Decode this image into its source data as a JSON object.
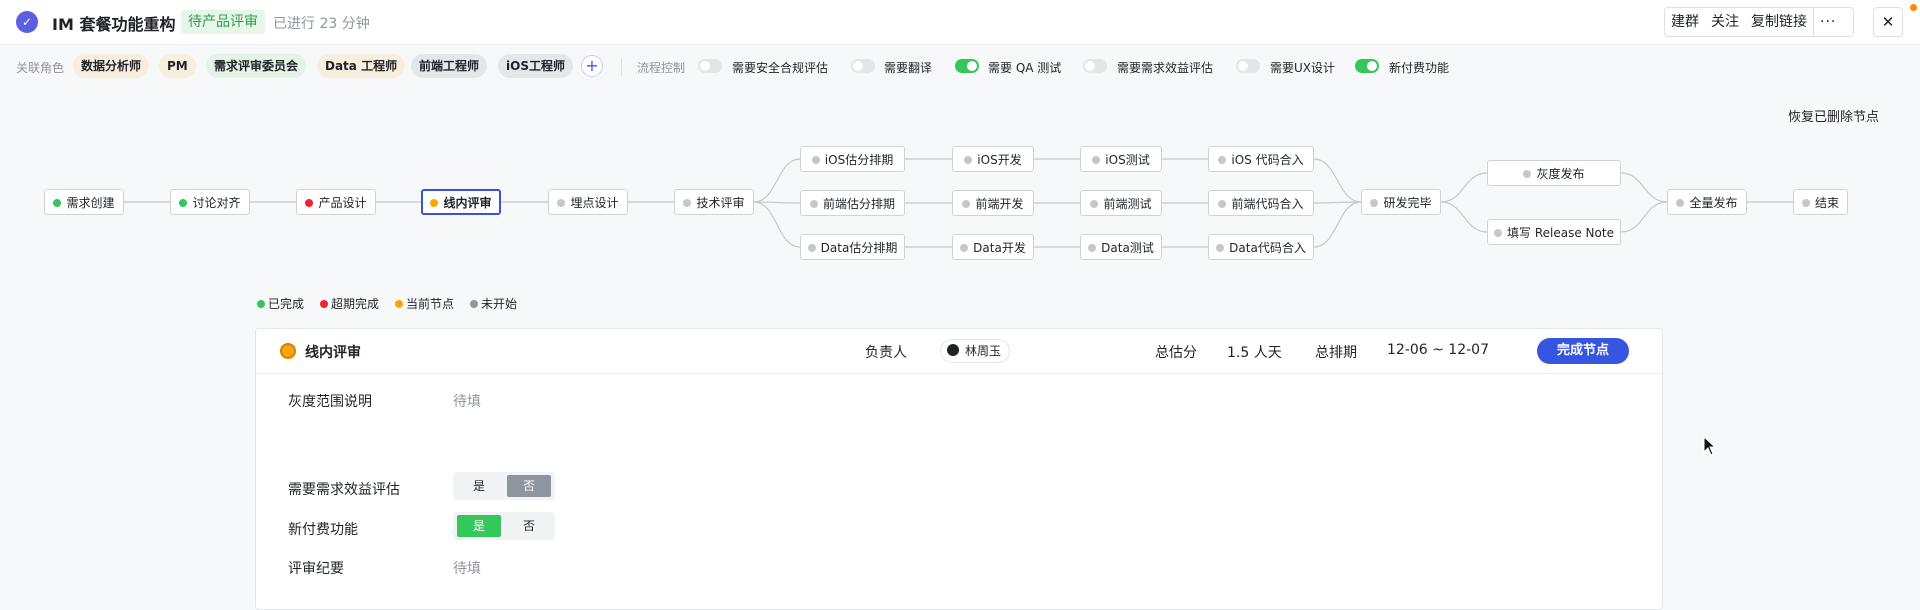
{
  "header": {
    "title": "IM 套餐功能重构",
    "status": "待产品评审",
    "elapsed": "已进行 23 分钟",
    "actions": [
      "建群",
      "关注",
      "复制链接"
    ],
    "more": "···",
    "close": "✕"
  },
  "toolbar": {
    "roles_label": "关联角色",
    "roles": [
      "数据分析师",
      "PM",
      "需求评审委员会",
      "Data 工程师",
      "前端工程师",
      "iOS工程师"
    ],
    "add": "+",
    "flow_label": "流程控制",
    "toggles": [
      {
        "label": "需要安全合规评估",
        "on": false
      },
      {
        "label": "需要翻译",
        "on": false
      },
      {
        "label": "需要 QA 测试",
        "on": true
      },
      {
        "label": "需要需求效益评估",
        "on": false
      },
      {
        "label": "需要UX设计",
        "on": false
      },
      {
        "label": "新付费功能",
        "on": true
      }
    ]
  },
  "restore_label": "恢复已删除节点",
  "flow": {
    "nodes": [
      {
        "id": "n1",
        "label": "需求创建",
        "status": "done"
      },
      {
        "id": "n2",
        "label": "讨论对齐",
        "status": "done"
      },
      {
        "id": "n3",
        "label": "产品设计",
        "status": "overdue"
      },
      {
        "id": "n4",
        "label": "线内评审",
        "status": "current"
      },
      {
        "id": "n5",
        "label": "埋点设计",
        "status": "notstarted"
      },
      {
        "id": "n6",
        "label": "技术评审",
        "status": "notstarted"
      },
      {
        "id": "ios1",
        "label": "iOS估分排期",
        "status": "notstarted"
      },
      {
        "id": "ios2",
        "label": "iOS开发",
        "status": "notstarted"
      },
      {
        "id": "ios3",
        "label": "iOS测试",
        "status": "notstarted"
      },
      {
        "id": "ios4",
        "label": "iOS 代码合入",
        "status": "notstarted"
      },
      {
        "id": "fe1",
        "label": "前端估分排期",
        "status": "notstarted"
      },
      {
        "id": "fe2",
        "label": "前端开发",
        "status": "notstarted"
      },
      {
        "id": "fe3",
        "label": "前端测试",
        "status": "notstarted"
      },
      {
        "id": "fe4",
        "label": "前端代码合入",
        "status": "notstarted"
      },
      {
        "id": "da1",
        "label": "Data估分排期",
        "status": "notstarted"
      },
      {
        "id": "da2",
        "label": "Data开发",
        "status": "notstarted"
      },
      {
        "id": "da3",
        "label": "Data测试",
        "status": "notstarted"
      },
      {
        "id": "da4",
        "label": "Data代码合入",
        "status": "notstarted"
      },
      {
        "id": "n7",
        "label": "研发完毕",
        "status": "notstarted"
      },
      {
        "id": "g1",
        "label": "灰度发布",
        "status": "notstarted"
      },
      {
        "id": "g2",
        "label": "填写 Release Note",
        "status": "notstarted"
      },
      {
        "id": "n8",
        "label": "全量发布",
        "status": "notstarted"
      },
      {
        "id": "n9",
        "label": "结束",
        "status": "notstarted"
      }
    ],
    "edges": [
      [
        "n1",
        "n2"
      ],
      [
        "n2",
        "n3"
      ],
      [
        "n3",
        "n4"
      ],
      [
        "n4",
        "n5"
      ],
      [
        "n5",
        "n6"
      ],
      [
        "n6",
        "ios1"
      ],
      [
        "n6",
        "fe1"
      ],
      [
        "n6",
        "da1"
      ],
      [
        "ios1",
        "ios2"
      ],
      [
        "ios2",
        "ios3"
      ],
      [
        "ios3",
        "ios4"
      ],
      [
        "fe1",
        "fe2"
      ],
      [
        "fe2",
        "fe3"
      ],
      [
        "fe3",
        "fe4"
      ],
      [
        "da1",
        "da2"
      ],
      [
        "da2",
        "da3"
      ],
      [
        "da3",
        "da4"
      ],
      [
        "ios4",
        "n7"
      ],
      [
        "fe4",
        "n7"
      ],
      [
        "da4",
        "n7"
      ],
      [
        "n7",
        "g1"
      ],
      [
        "n7",
        "g2"
      ],
      [
        "g1",
        "n8"
      ],
      [
        "g2",
        "n8"
      ],
      [
        "n8",
        "n9"
      ]
    ]
  },
  "legend": [
    {
      "label": "已完成",
      "color": "#34c759"
    },
    {
      "label": "超期完成",
      "color": "#f5222d"
    },
    {
      "label": "当前节点",
      "color": "#ffa500"
    },
    {
      "label": "未开始",
      "color": "#8f959e"
    }
  ],
  "detail": {
    "title": "线内评审",
    "owner_label": "负责人",
    "owner": "林周玉",
    "estimate_label": "总估分",
    "estimate": "1.5 人天",
    "schedule_label": "总排期",
    "schedule": "12-06 ~ 12-07",
    "complete_btn": "完成节点",
    "fields": {
      "gray_label": "灰度范围说明",
      "gray_value": "待填",
      "benefit_label": "需要需求效益评估",
      "paid_label": "新付费功能",
      "yes": "是",
      "no": "否",
      "benefit_selected": "否",
      "paid_selected": "是",
      "minutes_label": "评审纪要",
      "minutes_value": "待填"
    }
  }
}
